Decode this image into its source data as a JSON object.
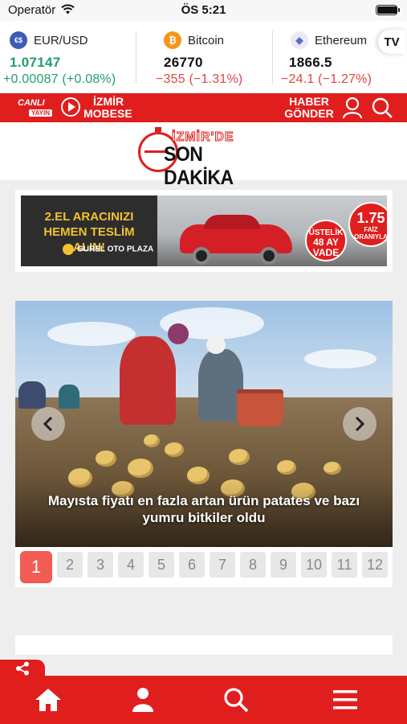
{
  "status_bar": {
    "carrier": "Operatör",
    "time": "ÖS 5:21",
    "battery_level": 1.0
  },
  "ticker": [
    {
      "symbol": "EUR/USD",
      "price": "1.07147",
      "change": "+0.00087 (+0.08%)",
      "direction": "up"
    },
    {
      "symbol": "Bitcoin",
      "price": "26770",
      "change": "−355 (−1.31%)",
      "direction": "down"
    },
    {
      "symbol": "Ethereum",
      "price": "1866.5",
      "change": "−24.1 (−1.27%)",
      "direction": "down"
    }
  ],
  "ticker_brand": "TV",
  "top_bar": {
    "live_label": "CANLI",
    "live_sub": "YAYIN",
    "mobese_line1": "İZMİR",
    "mobese_line2": "MOBESE",
    "haber_line1": "HABER",
    "haber_line2": "GÖNDER"
  },
  "logo": {
    "top": "İZMİR'DE",
    "main": "SON DAKİKA"
  },
  "ad": {
    "headline_line1": "2.EL ARACINIZI",
    "headline_line2": "HEMEN TESLİM ALIN!",
    "brand": "GUREL OTO PLAZA",
    "badge1_line1": "ÜSTELİK",
    "badge1_line2": "48 AY",
    "badge1_line3": "VADE",
    "badge2_rate": "1.75",
    "badge2_label": "ORANIYLA",
    "badge2_faiz": "FAİZ"
  },
  "slider": {
    "caption": "Mayısta fiyatı en fazla artan ürün patates ve bazı yumru bitkiler oldu",
    "prev_icon": "chevron-left-icon",
    "next_icon": "chevron-right-icon"
  },
  "pagination": {
    "pages": [
      "1",
      "2",
      "3",
      "4",
      "5",
      "6",
      "7",
      "8",
      "9",
      "10",
      "11",
      "12"
    ],
    "active": "1"
  },
  "bottom_nav": [
    "home-icon",
    "user-icon",
    "search-icon",
    "menu-icon"
  ],
  "colors": {
    "brand_red": "#e01e1e",
    "up": "#22a06b",
    "down": "#e0473f",
    "active_page": "#f25c54"
  }
}
